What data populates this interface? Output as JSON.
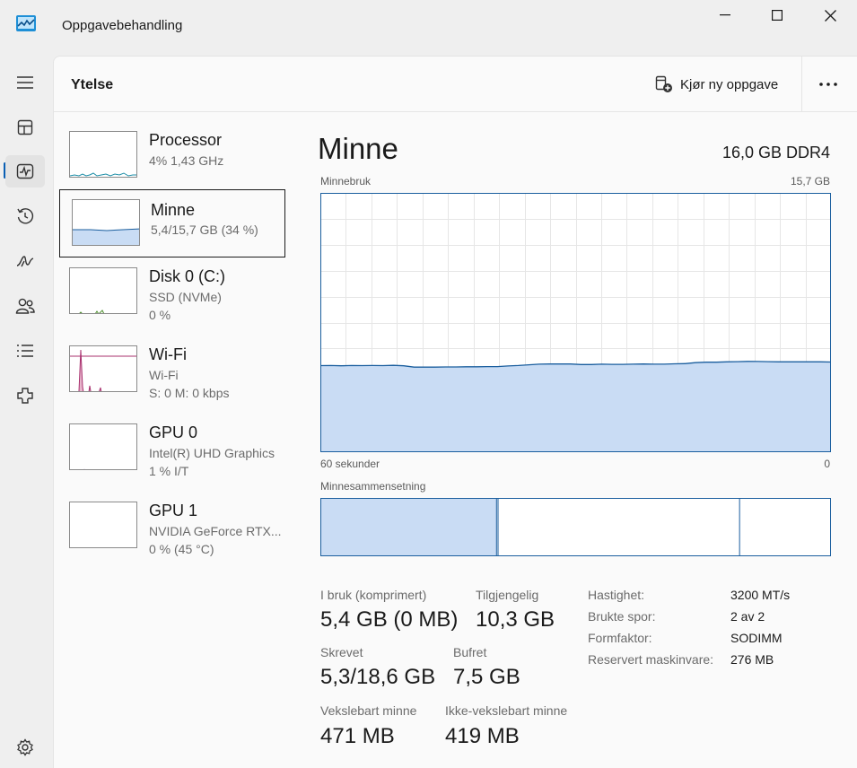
{
  "window": {
    "title": "Oppgavebehandling"
  },
  "nav": {
    "items": [
      "hamburger-icon",
      "processes-icon",
      "performance-icon",
      "app-history-icon",
      "startup-apps-icon",
      "users-icon",
      "details-icon",
      "services-icon",
      "settings-icon"
    ],
    "active": "performance"
  },
  "header": {
    "title": "Ytelse",
    "run_task_label": "Kjør ny oppgave"
  },
  "devices": [
    {
      "name": "Processor",
      "line1": "4% 1,43 GHz",
      "line2": ""
    },
    {
      "name": "Minne",
      "line1": "5,4/15,7 GB (34 %)",
      "line2": ""
    },
    {
      "name": "Disk 0 (C:)",
      "line1": "SSD (NVMe)",
      "line2": "0 %"
    },
    {
      "name": "Wi-Fi",
      "line1": "Wi-Fi",
      "line2": "S: 0 M: 0 kbps"
    },
    {
      "name": "GPU 0",
      "line1": "Intel(R) UHD Graphics",
      "line2": "1 % I/T"
    },
    {
      "name": "GPU 1",
      "line1": "NVIDIA GeForce RTX...",
      "line2": "0 % (45 °C)"
    }
  ],
  "memory": {
    "title": "Minne",
    "spec": "16,0 GB DDR4",
    "usage_label": "Minnebruk",
    "usage_max": "15,7 GB",
    "time_left": "60 sekunder",
    "time_right": "0",
    "composition_label": "Minnesammensetning",
    "composition_fraction_in_use": 0.345,
    "composition_fraction_modified": 0.003,
    "composition_fraction_standby": 0.473,
    "usage_history_gb": [
      5.24,
      5.25,
      5.23,
      5.25,
      5.24,
      5.25,
      5.24,
      5.26,
      5.23,
      5.15,
      5.15,
      5.15,
      5.16,
      5.16,
      5.17,
      5.17,
      5.18,
      5.18,
      5.22,
      5.25,
      5.29,
      5.33,
      5.34,
      5.34,
      5.34,
      5.31,
      5.31,
      5.33,
      5.32,
      5.32,
      5.33,
      5.34,
      5.33,
      5.33,
      5.35,
      5.36,
      5.42,
      5.45,
      5.45,
      5.47,
      5.48,
      5.5,
      5.49,
      5.48,
      5.47,
      5.47,
      5.47,
      5.47,
      5.47,
      5.46
    ],
    "usage_max_gb": 15.7
  },
  "stats": {
    "in_use": {
      "label": "I bruk (komprimert)",
      "value": "5,4 GB (0 MB)"
    },
    "available": {
      "label": "Tilgjengelig",
      "value": "10,3 GB"
    },
    "committed": {
      "label": "Skrevet",
      "value": "5,3/18,6 GB"
    },
    "cached": {
      "label": "Bufret",
      "value": "7,5 GB"
    },
    "paged": {
      "label": "Vekslebart minne",
      "value": "471 MB"
    },
    "nonpaged": {
      "label": "Ikke-vekslebart minne",
      "value": "419 MB"
    }
  },
  "props": [
    {
      "label": "Hastighet:",
      "value": "3200 MT/s"
    },
    {
      "label": "Brukte spor:",
      "value": "2 av 2"
    },
    {
      "label": "Formfaktor:",
      "value": "SODIMM"
    },
    {
      "label": "Reservert maskinvare:",
      "value": "276 MB"
    }
  ],
  "colors": {
    "accent": "#0a5fb4",
    "memory_line": "#1a5e9e",
    "memory_fill": "#c9dcf4",
    "cpu_line": "#1f8fa8",
    "disk_line": "#4e8f2e",
    "wifi_line": "#a8306e",
    "gpu_line": "#8a3cc2"
  }
}
